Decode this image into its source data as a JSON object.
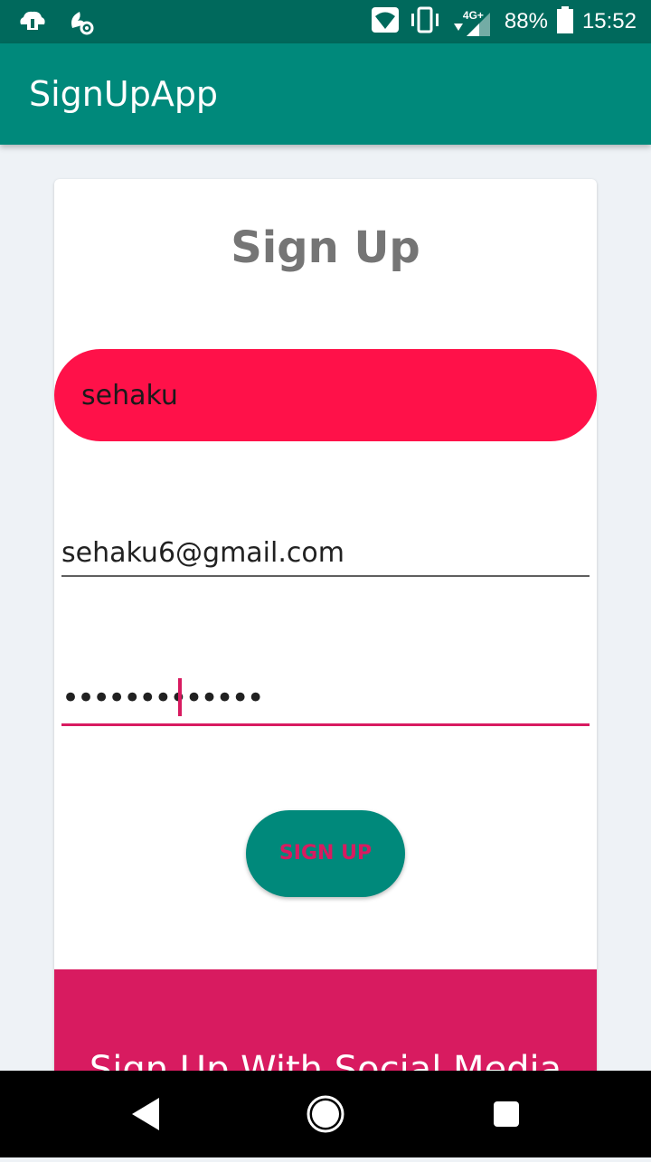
{
  "status_bar": {
    "battery": "88%",
    "time": "15:52",
    "network": "4G+",
    "icons": [
      "cloud-download-icon",
      "settings-icon",
      "wifi-icon",
      "vibrate-icon",
      "signal-icon",
      "battery-icon"
    ]
  },
  "app_bar": {
    "title": "SignUpApp"
  },
  "form": {
    "title": "Sign Up",
    "username_value": "sehaku",
    "email_value": "sehaku6@gmail.com",
    "password_masked": "•••••••••••••",
    "submit_label": "SIGN UP"
  },
  "social": {
    "label": "Sign Up With Social Media"
  },
  "nav_bar": {
    "icons": [
      "back-icon",
      "home-icon",
      "recents-icon"
    ]
  },
  "colors": {
    "status_bar": "#00695c",
    "app_bar": "#00897b",
    "accent": "#d81b60",
    "username_field": "#ff1149",
    "background": "#eef2f6"
  }
}
